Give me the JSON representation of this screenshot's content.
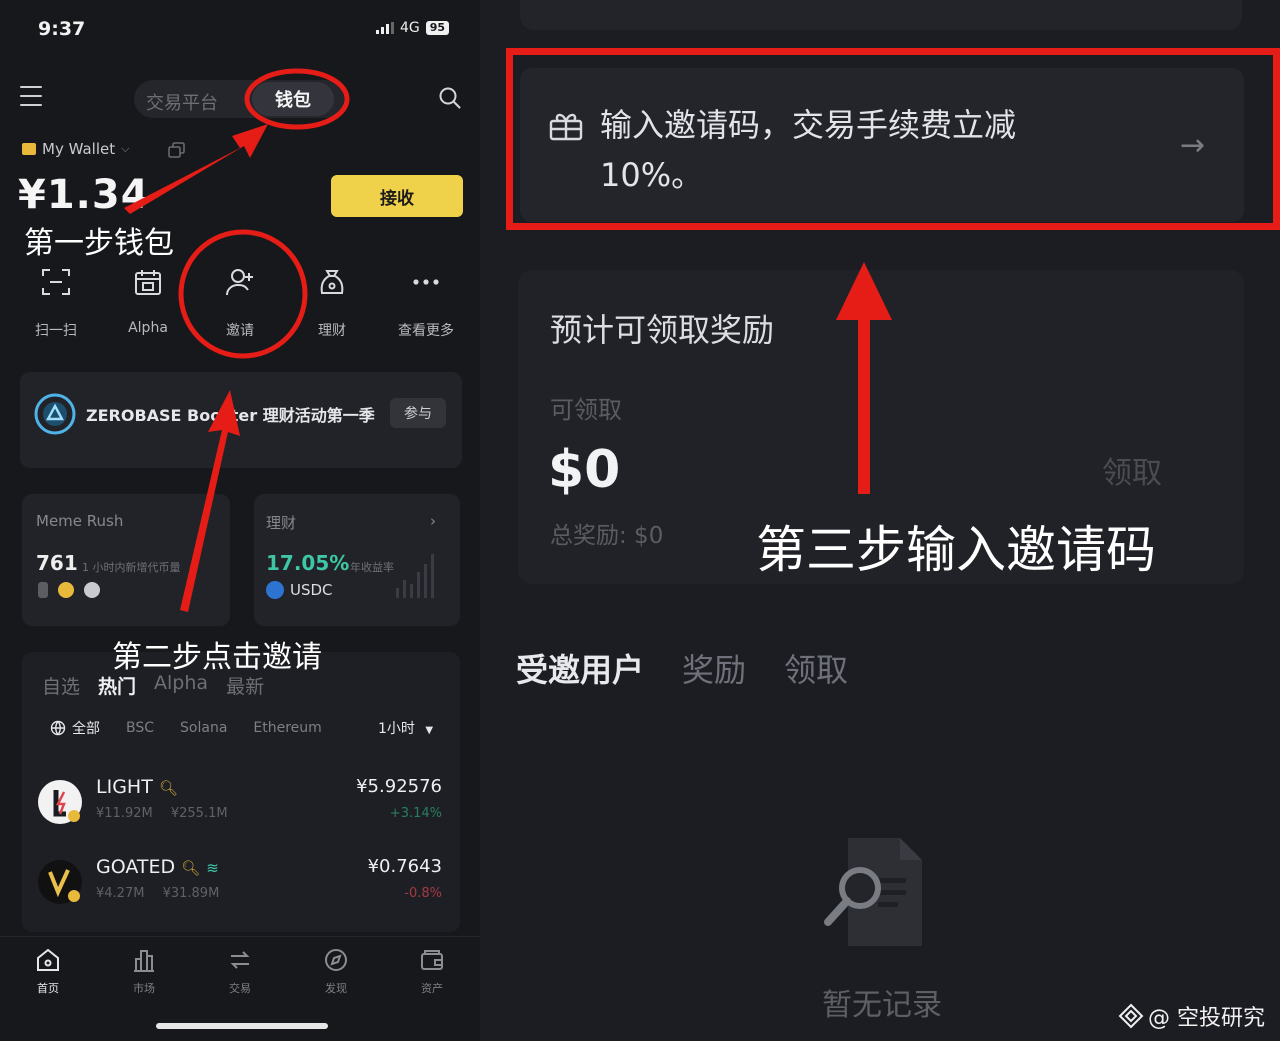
{
  "status_bar": {
    "time": "9:37",
    "network": "4G",
    "battery": "95"
  },
  "header": {
    "tab_exchange": "交易平台",
    "tab_wallet": "钱包"
  },
  "wallet": {
    "name": "My Wallet",
    "balance": "¥1.34",
    "receive_label": "接收"
  },
  "quick_actions": [
    {
      "label": "扫一扫",
      "icon": "scan-icon"
    },
    {
      "label": "Alpha",
      "icon": "alpha-icon"
    },
    {
      "label": "邀请",
      "icon": "add-user-icon"
    },
    {
      "label": "理财",
      "icon": "money-bag-icon"
    },
    {
      "label": "查看更多",
      "icon": "more-icon"
    }
  ],
  "promo": {
    "title": "ZEROBASE Booster 理财活动第一季",
    "button": "参与"
  },
  "meme_card": {
    "title": "Meme Rush",
    "value": "761",
    "subtitle": "1 小时内新增代币量"
  },
  "earn_card": {
    "title": "理财",
    "apy": "17.05%",
    "apy_label": "年收益率",
    "coin": "USDC"
  },
  "market": {
    "tabs": [
      "自选",
      "热门",
      "Alpha",
      "最新"
    ],
    "active_tab": "热门",
    "chains": [
      "全部",
      "BSC",
      "Solana",
      "Ethereum"
    ],
    "timeframe": "1小时",
    "rows": [
      {
        "name": "LIGHT",
        "volume": "¥11.92M",
        "mcap": "¥255.1M",
        "price": "¥5.92576",
        "change": "+3.14%",
        "change_color": "#2ebd85"
      },
      {
        "name": "GOATED",
        "volume": "¥4.27M",
        "mcap": "¥31.89M",
        "price": "¥0.7643",
        "change": "-0.8%",
        "change_color": "#e0454d"
      }
    ]
  },
  "bottom_nav": [
    {
      "label": "首页",
      "icon": "home-icon"
    },
    {
      "label": "市场",
      "icon": "market-icon"
    },
    {
      "label": "交易",
      "icon": "swap-icon"
    },
    {
      "label": "发现",
      "icon": "compass-icon"
    },
    {
      "label": "资产",
      "icon": "wallet-icon"
    }
  ],
  "invite_panel": {
    "invite_text_line1": "输入邀请码，交易手续费立减",
    "invite_text_line2": "10%。",
    "reward_title": "预计可领取奖励",
    "claimable_label": "可领取",
    "claimable_amount": "$0",
    "claim_button": "领取",
    "total_reward": "总奖励: $0",
    "tabs": [
      "受邀用户",
      "奖励",
      "领取"
    ],
    "empty_text": "暂无记录"
  },
  "annotations": {
    "step1": "第一步钱包",
    "step2": "第二步点击邀请",
    "step3": "第三步输入邀请码",
    "color": "#e61d16"
  },
  "watermark": "@ 空投研究"
}
